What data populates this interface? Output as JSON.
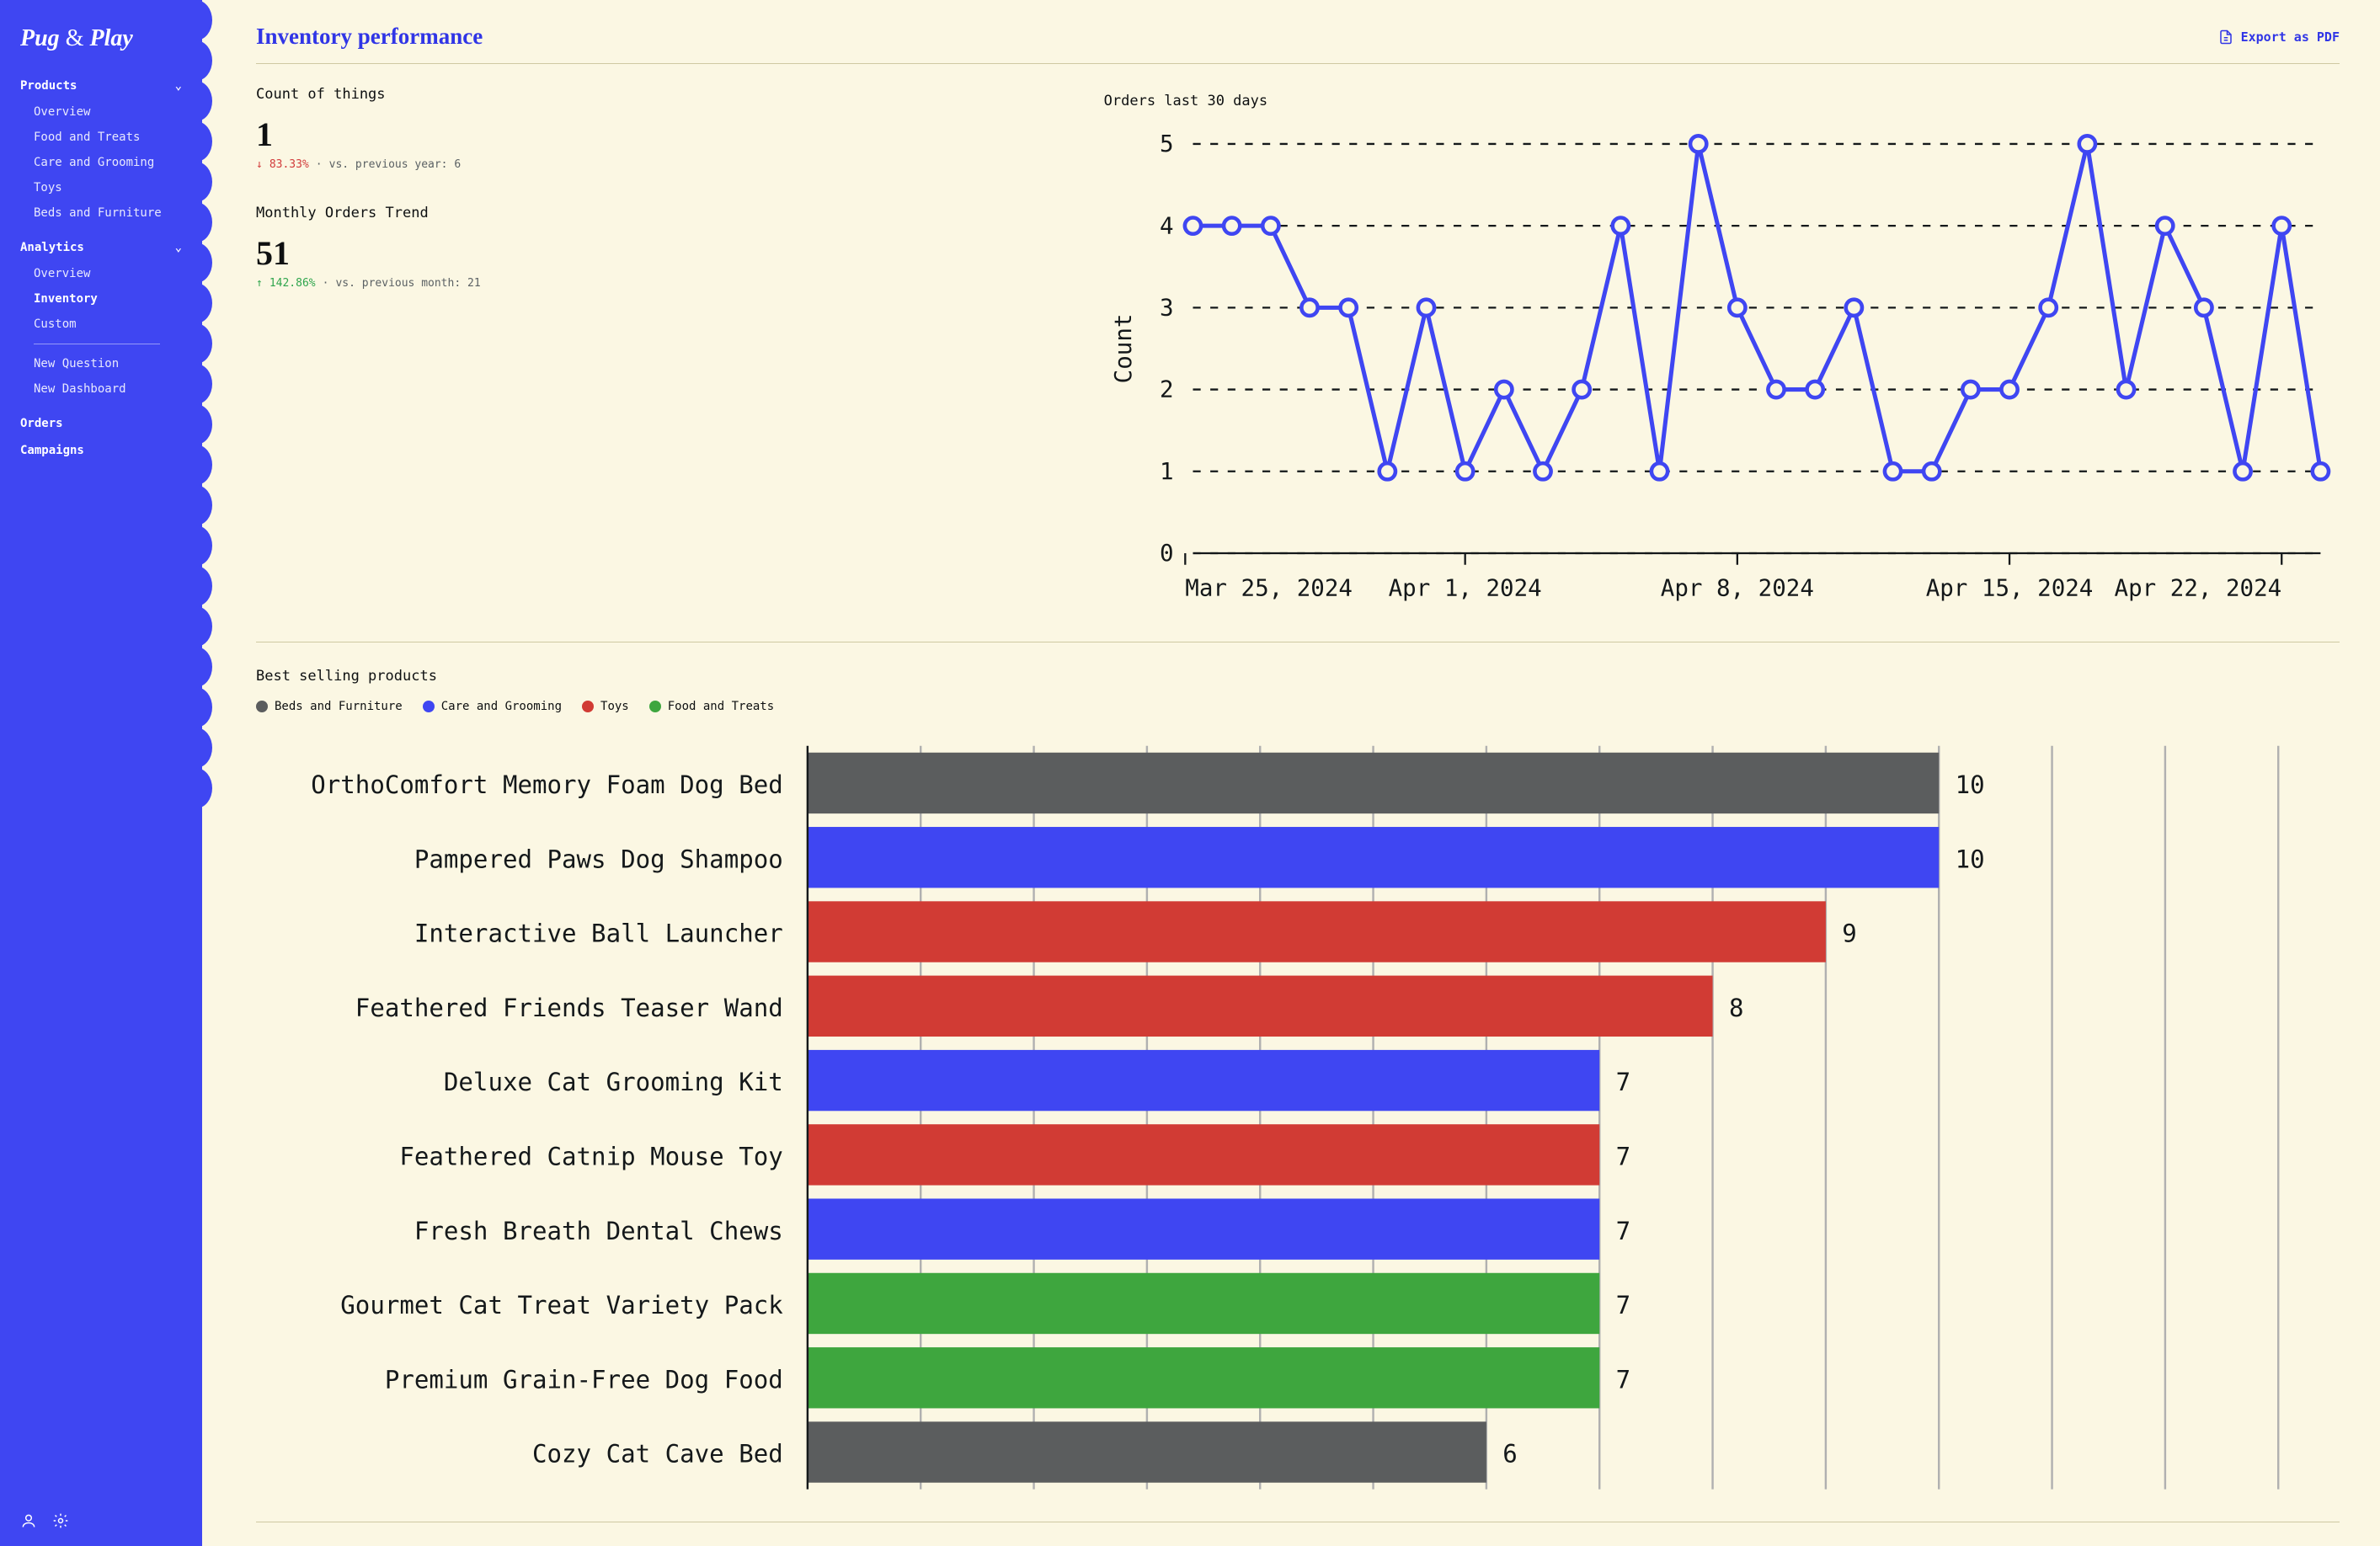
{
  "brand": {
    "name": "Pug & Play"
  },
  "sidebar": {
    "groups": [
      {
        "label": "Products",
        "items": [
          {
            "label": "Overview"
          },
          {
            "label": "Food and Treats"
          },
          {
            "label": "Care and Grooming"
          },
          {
            "label": "Toys"
          },
          {
            "label": "Beds and Furniture"
          }
        ]
      },
      {
        "label": "Analytics",
        "items": [
          {
            "label": "Overview"
          },
          {
            "label": "Inventory",
            "active": true
          },
          {
            "label": "Custom"
          }
        ],
        "extras": [
          {
            "label": "New Question"
          },
          {
            "label": "New Dashboard"
          }
        ]
      }
    ],
    "simple": [
      {
        "label": "Orders"
      },
      {
        "label": "Campaigns"
      }
    ]
  },
  "header": {
    "title": "Inventory performance",
    "export_label": "Export as PDF"
  },
  "metric_a": {
    "title": "Count of things",
    "value": "1",
    "direction": "down",
    "delta_pct": "83.33%",
    "compare_label": "vs. previous year: 6"
  },
  "metric_b": {
    "title": "Monthly Orders Trend",
    "value": "51",
    "direction": "up",
    "delta_pct": "142.86%",
    "compare_label": "vs. previous month: 21"
  },
  "orders_chart_title": "Orders last 30 days",
  "best_title": "Best selling products",
  "legend": {
    "beds": {
      "label": "Beds and Furniture",
      "color": "#5b5d5e"
    },
    "care": {
      "label": "Care and Grooming",
      "color": "#3f46f2"
    },
    "toys": {
      "label": "Toys",
      "color": "#d13b34"
    },
    "food": {
      "label": "Food and Treats",
      "color": "#3ea63e"
    }
  },
  "chart_data": [
    {
      "id": "orders_30d",
      "type": "line",
      "title": "Orders last 30 days",
      "ylabel": "Count",
      "xlabel": "",
      "ylim": [
        0,
        5
      ],
      "xtick_labels": [
        "Mar 25, 2024",
        "Apr 1, 2024",
        "Apr 8, 2024",
        "Apr 15, 2024",
        "Apr 22, 2024"
      ],
      "x": [
        0,
        1,
        2,
        3,
        4,
        5,
        6,
        7,
        8,
        9,
        10,
        11,
        12,
        13,
        14,
        15,
        16,
        17,
        18,
        19,
        20,
        21,
        22,
        23,
        24,
        25,
        26,
        27,
        28,
        29
      ],
      "values": [
        4,
        4,
        4,
        3,
        3,
        1,
        3,
        1,
        2,
        1,
        2,
        4,
        1,
        5,
        3,
        2,
        2,
        3,
        1,
        1,
        2,
        2,
        3,
        5,
        2,
        4,
        3,
        1,
        4,
        1
      ]
    },
    {
      "id": "best_sellers",
      "type": "bar",
      "orientation": "horizontal",
      "title": "Best selling products",
      "xlim": [
        0,
        13
      ],
      "categories": [
        "OrthoComfort Memory Foam Dog Bed",
        "Pampered Paws Dog Shampoo",
        "Interactive Ball Launcher",
        "Feathered Friends Teaser Wand",
        "Deluxe Cat Grooming Kit",
        "Feathered Catnip Mouse Toy",
        "Fresh Breath Dental Chews",
        "Gourmet Cat Treat Variety Pack",
        "Premium Grain-Free Dog Food",
        "Cozy Cat Cave Bed"
      ],
      "values": [
        10,
        10,
        9,
        8,
        7,
        7,
        7,
        7,
        7,
        6
      ],
      "group": [
        "beds",
        "care",
        "toys",
        "toys",
        "care",
        "toys",
        "care",
        "food",
        "food",
        "beds"
      ]
    }
  ]
}
